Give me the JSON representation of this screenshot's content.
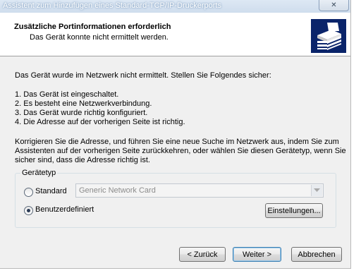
{
  "window": {
    "title": "Assistent zum Hinzufügen eines Standard-TCP/IP-Druckerports",
    "close_symbol": "✕"
  },
  "header": {
    "title": "Zusätzliche Portinformationen erforderlich",
    "subtitle": "Das Gerät konnte nicht ermittelt werden.",
    "icon": "printer-icon"
  },
  "body": {
    "intro": "Das Gerät wurde im Netzwerk nicht ermittelt. Stellen Sie Folgendes sicher:",
    "checklist": [
      "1.  Das Gerät ist eingeschaltet.",
      "2.  Es besteht eine Netzwerkverbindung.",
      "3.  Das Gerät wurde richtig konfiguriert.",
      "4.  Die Adresse auf der vorherigen Seite ist richtig."
    ],
    "instructions": [
      "Korrigieren Sie die Adresse, und führen Sie eine neue Suche im Netzwerk aus, indem Sie zum",
      "Assistenten auf der vorherigen Seite zurückkehren, oder wählen Sie diesen Gerätetyp, wenn Sie",
      "sicher sind, dass die Adresse richtig ist."
    ]
  },
  "device_type": {
    "legend": "Gerätetyp",
    "standard_label": "Standard",
    "standard_selected": false,
    "standard_value": "Generic Network Card",
    "custom_label": "Benutzerdefiniert",
    "custom_selected": true,
    "settings_button": "Einstellungen..."
  },
  "footer": {
    "back_button": "< Zurück",
    "next_button": "Weiter >",
    "cancel_button": "Abbrechen"
  },
  "colors": {
    "icon_background": "#0a246a",
    "default_button_border": "#3c7fb1"
  }
}
